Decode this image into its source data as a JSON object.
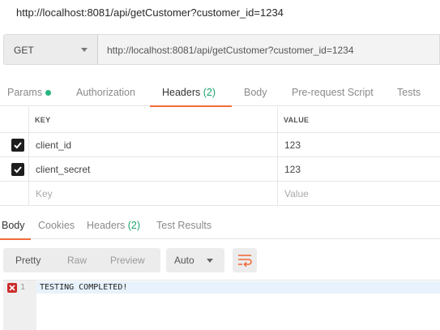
{
  "window": {
    "title": "http://localhost:8081/api/getCustomer?customer_id=1234"
  },
  "request": {
    "method": "GET",
    "url": "http://localhost:8081/api/getCustomer?customer_id=1234"
  },
  "request_tabs": [
    {
      "label": "Params",
      "has_dot": true
    },
    {
      "label": "Authorization"
    },
    {
      "label": "Headers",
      "count": "(2)",
      "active": true
    },
    {
      "label": "Body"
    },
    {
      "label": "Pre-request Script"
    },
    {
      "label": "Tests"
    }
  ],
  "headers_table": {
    "columns": [
      "KEY",
      "VALUE"
    ],
    "rows": [
      {
        "checked": true,
        "key": "client_id",
        "value": "123"
      },
      {
        "checked": true,
        "key": "client_secret",
        "value": "123"
      }
    ],
    "new_row": {
      "key_placeholder": "Key",
      "value_placeholder": "Value"
    }
  },
  "response_tabs": [
    {
      "label": "Body",
      "active": true
    },
    {
      "label": "Cookies"
    },
    {
      "label": "Headers",
      "count": "(2)"
    },
    {
      "label": "Test Results"
    }
  ],
  "response_toolbar": {
    "view_modes": [
      "Pretty",
      "Raw",
      "Preview"
    ],
    "active_view": "Pretty",
    "format": "Auto"
  },
  "response_body": {
    "lines": [
      {
        "number": "1",
        "text": "TESTING COMPLETED!",
        "has_error_marker": true
      }
    ]
  },
  "colors": {
    "accent": "#f26b3a",
    "count_green": "#1aa36b",
    "error_red": "#cc2a2a"
  }
}
